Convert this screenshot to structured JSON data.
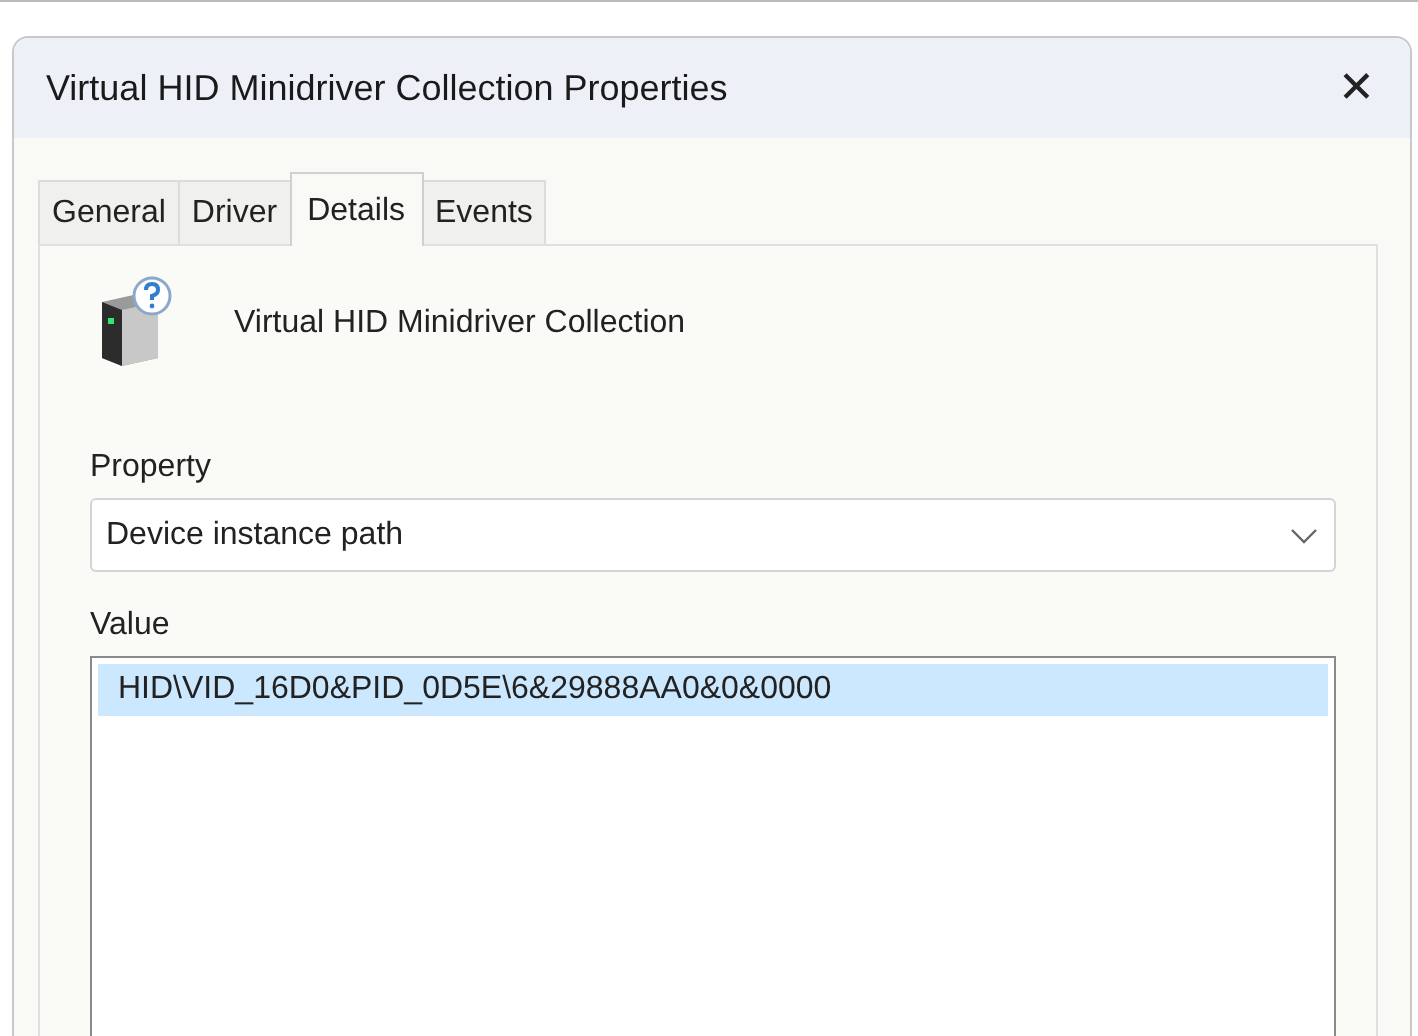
{
  "window": {
    "title": "Virtual HID Minidriver Collection Properties",
    "close": "✕"
  },
  "tabs": [
    {
      "label": "General",
      "selected": false
    },
    {
      "label": "Driver",
      "selected": false
    },
    {
      "label": "Details",
      "selected": true
    },
    {
      "label": "Events",
      "selected": false
    }
  ],
  "device": {
    "name": "Virtual HID Minidriver Collection"
  },
  "property": {
    "label": "Property",
    "value": "Device instance path"
  },
  "value": {
    "label": "Value",
    "items": [
      {
        "text": "HID\\VID_16D0&PID_0D5E\\6&29888AA0&0&0000",
        "selected": true
      }
    ]
  }
}
